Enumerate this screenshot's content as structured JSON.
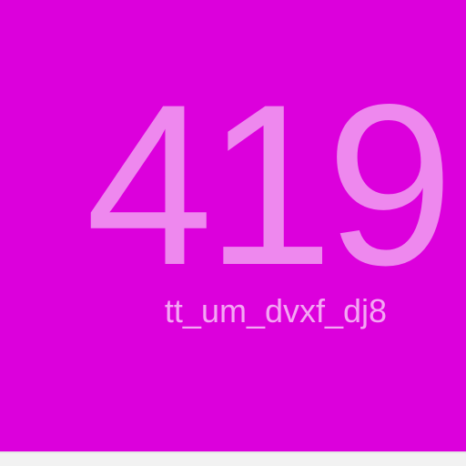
{
  "display": {
    "value": "419",
    "label": "tt_um_dvxf_dj8"
  },
  "colors": {
    "background": "#dc00dc",
    "value_text": "#ee88ee",
    "label_text": "#f4a6f4",
    "bottom_bar": "#f2f2f2"
  }
}
